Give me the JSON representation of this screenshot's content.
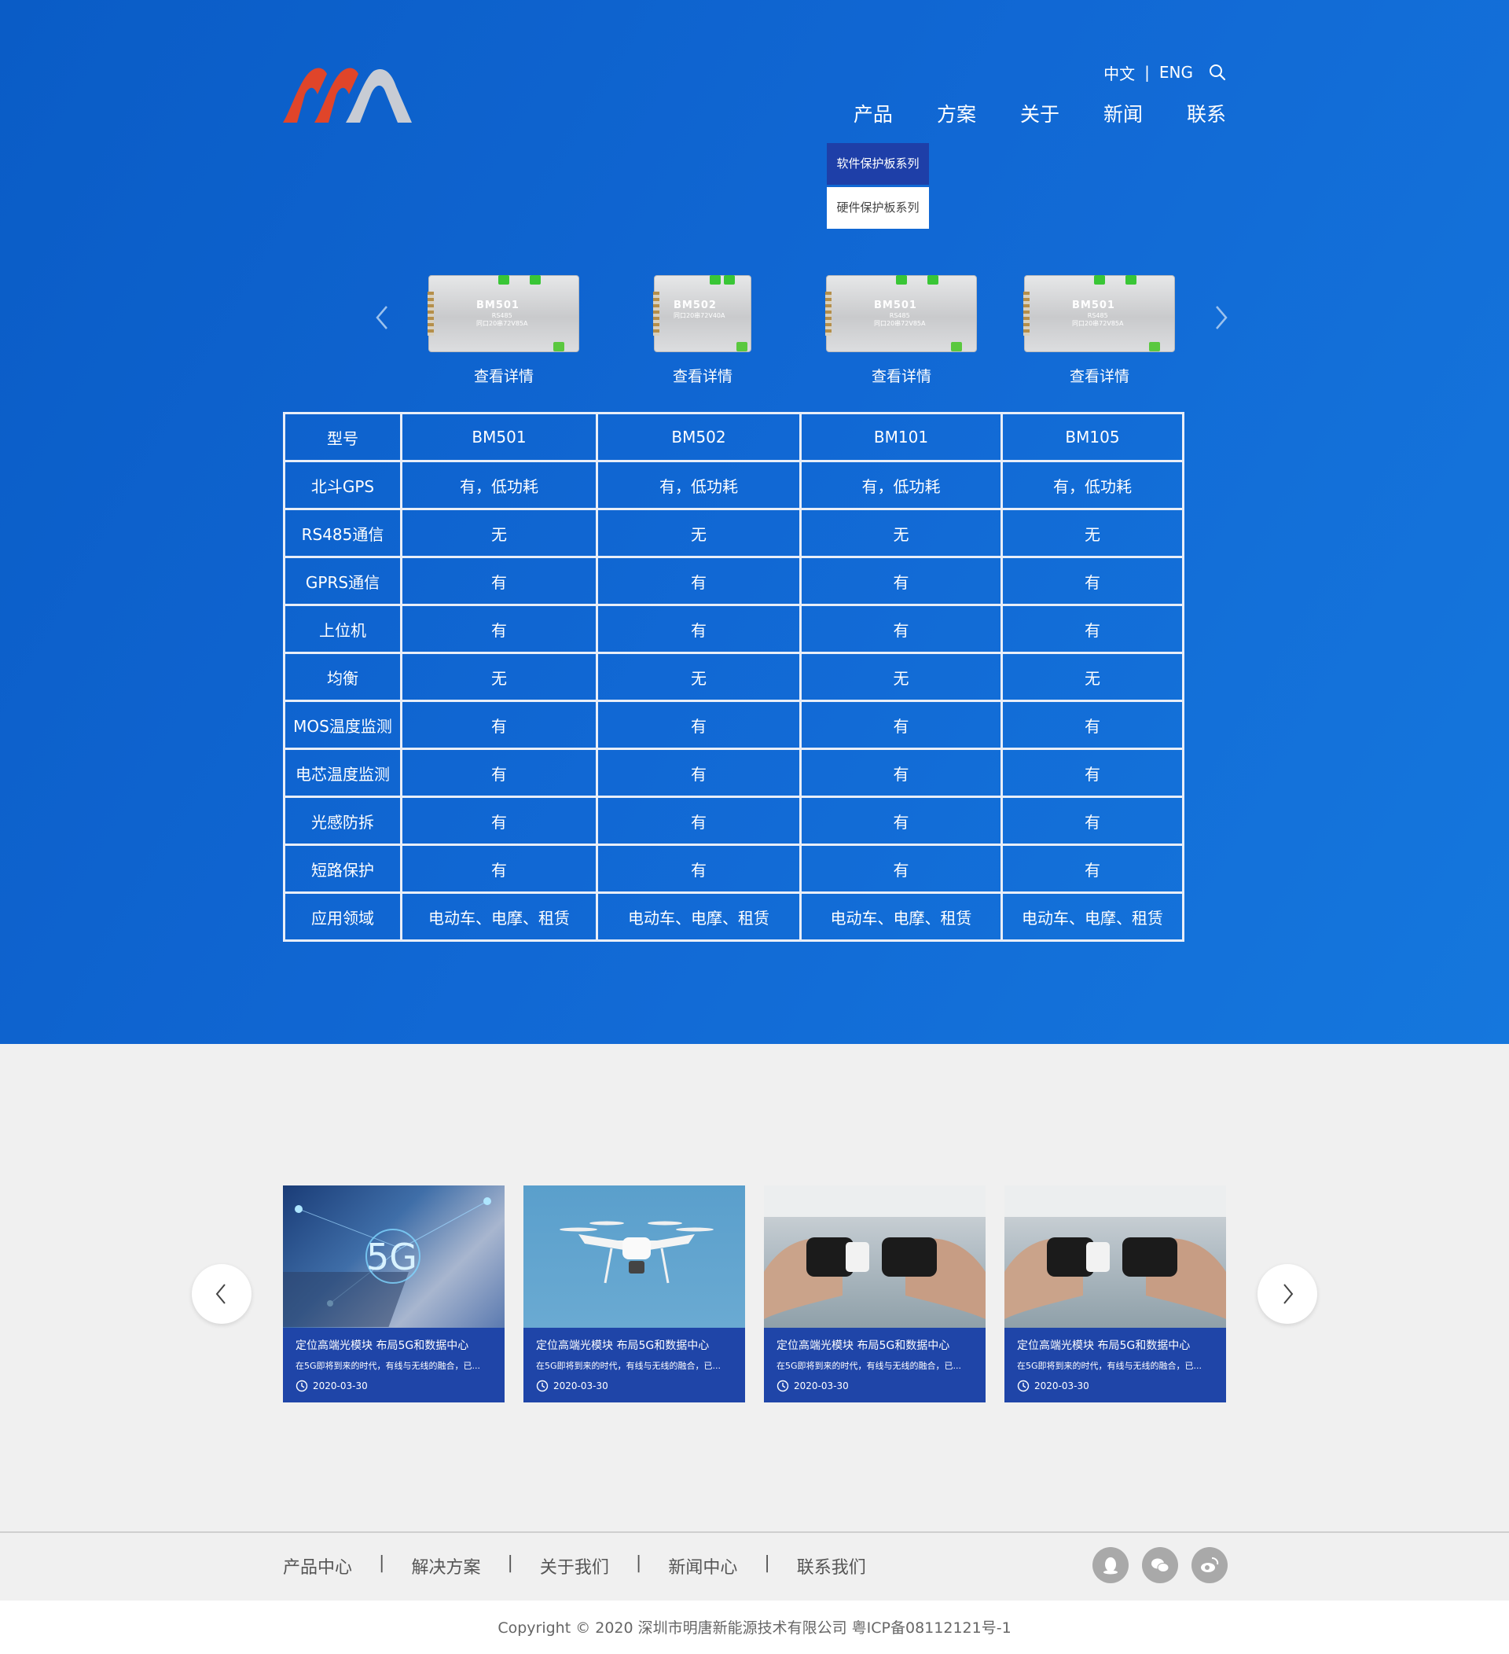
{
  "header": {
    "lang_cn": "中文",
    "lang_sep": "|",
    "lang_en": "ENG",
    "nav": [
      "产品",
      "方案",
      "关于",
      "新闻",
      "联系"
    ]
  },
  "dropdown": [
    "软件保护板系列",
    "硬件保护板系列"
  ],
  "products": [
    {
      "name": "BM501",
      "sub1": "RS485",
      "sub2": "同口20串72V85A",
      "detail": "查看详情"
    },
    {
      "name": "BM502",
      "sub1": "同口20串72V40A",
      "sub2": "",
      "detail": "查看详情"
    },
    {
      "name": "BM501",
      "sub1": "RS485",
      "sub2": "同口20串72V85A",
      "detail": "查看详情"
    },
    {
      "name": "BM501",
      "sub1": "RS485",
      "sub2": "同口20串72V85A",
      "detail": "查看详情"
    }
  ],
  "spec": {
    "header": [
      "型号",
      "BM501",
      "BM502",
      "BM101",
      "BM105"
    ],
    "rows": [
      [
        "北斗GPS",
        "有，低功耗",
        "有，低功耗",
        "有，低功耗",
        "有，低功耗"
      ],
      [
        "RS485通信",
        "无",
        "无",
        "无",
        "无"
      ],
      [
        "GPRS通信",
        "有",
        "有",
        "有",
        "有"
      ],
      [
        "上位机",
        "有",
        "有",
        "有",
        "有"
      ],
      [
        "均衡",
        "无",
        "无",
        "无",
        "无"
      ],
      [
        "MOS温度监测",
        "有",
        "有",
        "有",
        "有"
      ],
      [
        "电芯温度监测",
        "有",
        "有",
        "有",
        "有"
      ],
      [
        "光感防拆",
        "有",
        "有",
        "有",
        "有"
      ],
      [
        "短路保护",
        "有",
        "有",
        "有",
        "有"
      ],
      [
        "应用领域",
        "电动车、电摩、租赁",
        "电动车、电摩、租赁",
        "电动车、电摩、租赁",
        "电动车、电摩、租赁"
      ]
    ]
  },
  "news": [
    {
      "image": "5g-tech-photo",
      "image_text": "5G",
      "title": "定位高端光模块 布局5G和数据中心",
      "desc": "在5G即将到来的时代，有线与无线的融合，已...",
      "date": "2020-03-30"
    },
    {
      "image": "drone-photo",
      "title": "定位高端光模块 布局5G和数据中心",
      "desc": "在5G即将到来的时代，有线与无线的融合，已...",
      "date": "2020-03-30"
    },
    {
      "image": "connector-hands-photo",
      "title": "定位高端光模块 布局5G和数据中心",
      "desc": "在5G即将到来的时代，有线与无线的融合，已...",
      "date": "2020-03-30"
    },
    {
      "image": "connector-hands-photo",
      "title": "定位高端光模块 布局5G和数据中心",
      "desc": "在5G即将到来的时代，有线与无线的融合，已...",
      "date": "2020-03-30"
    }
  ],
  "footer": {
    "nav": [
      "产品中心",
      "解决方案",
      "关于我们",
      "新闻中心",
      "联系我们"
    ],
    "sep": "|",
    "social": [
      "qq-icon",
      "wechat-icon",
      "weibo-icon"
    ],
    "copyright": "Copyright © 2020  深圳市明唐新能源技术有限公司  粤ICP备08112121号-1"
  },
  "colors": {
    "hero_blue": "#1168d4",
    "card_blue": "#1f45a8",
    "dropdown_active": "#1e3fa8",
    "logo_red": "#e0452a",
    "logo_gray": "#c8ccd4"
  }
}
